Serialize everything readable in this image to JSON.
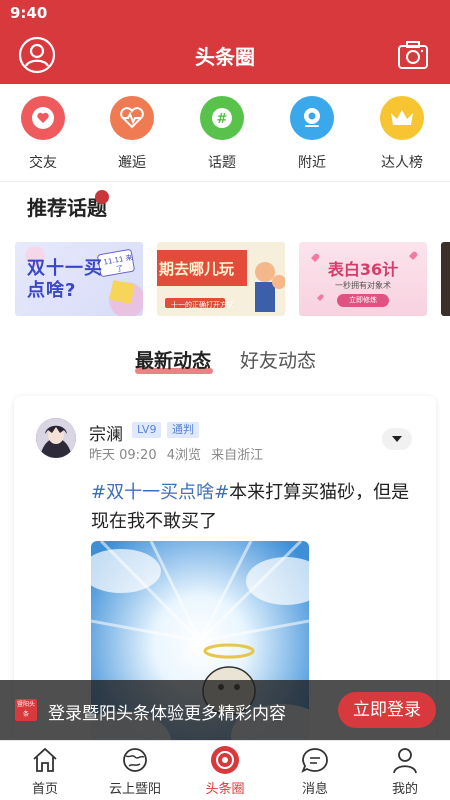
{
  "status_bar": {
    "time": "9:40"
  },
  "header": {
    "title": "头条圈",
    "avatar_icon": "user-icon",
    "camera_icon": "camera-icon",
    "color": "#d8393c"
  },
  "quick_nav": [
    {
      "label": "交友",
      "icon": "heart-icon",
      "color": "#ef5b5d"
    },
    {
      "label": "邂逅",
      "icon": "heartbeat-icon",
      "color": "#f07a52"
    },
    {
      "label": "话题",
      "icon": "hashtag-icon",
      "color": "#58c24a"
    },
    {
      "label": "附近",
      "icon": "location-icon",
      "color": "#3aa8ea"
    },
    {
      "label": "达人榜",
      "icon": "crown-icon",
      "color": "#f7c531"
    }
  ],
  "recommended_topics": {
    "title": "推荐话题",
    "cards": [
      {
        "text": "双十一买点啥?",
        "sticker": "11.11 来了"
      },
      {
        "text": "期去哪儿玩",
        "subtext": "十一的正确打开方式"
      },
      {
        "text": "表白36计",
        "subtext": "一秒拥有对象术",
        "button": "立即修炼"
      }
    ]
  },
  "feed_tabs": {
    "active": "最新动态",
    "inactive": "好友动态"
  },
  "post": {
    "username": "宗澜",
    "level_badge": "LV9",
    "role_badge": "通判",
    "time": "昨天 09:20",
    "views": "4浏览",
    "location": "来自浙江",
    "hashtag": "#双十一买点啥#",
    "text": "本来打算买猫砂，但是现在我不敢买了"
  },
  "login_banner": {
    "logo_text": "暨阳头条",
    "text": "登录暨阳头条体验更多精彩内容",
    "button": "立即登录"
  },
  "bottom_nav": [
    {
      "label": "首页",
      "icon": "home-icon"
    },
    {
      "label": "云上暨阳",
      "icon": "globe-icon"
    },
    {
      "label": "头条圈",
      "icon": "headline-circle-icon",
      "active": true
    },
    {
      "label": "消息",
      "icon": "message-icon"
    },
    {
      "label": "我的",
      "icon": "profile-icon"
    }
  ]
}
